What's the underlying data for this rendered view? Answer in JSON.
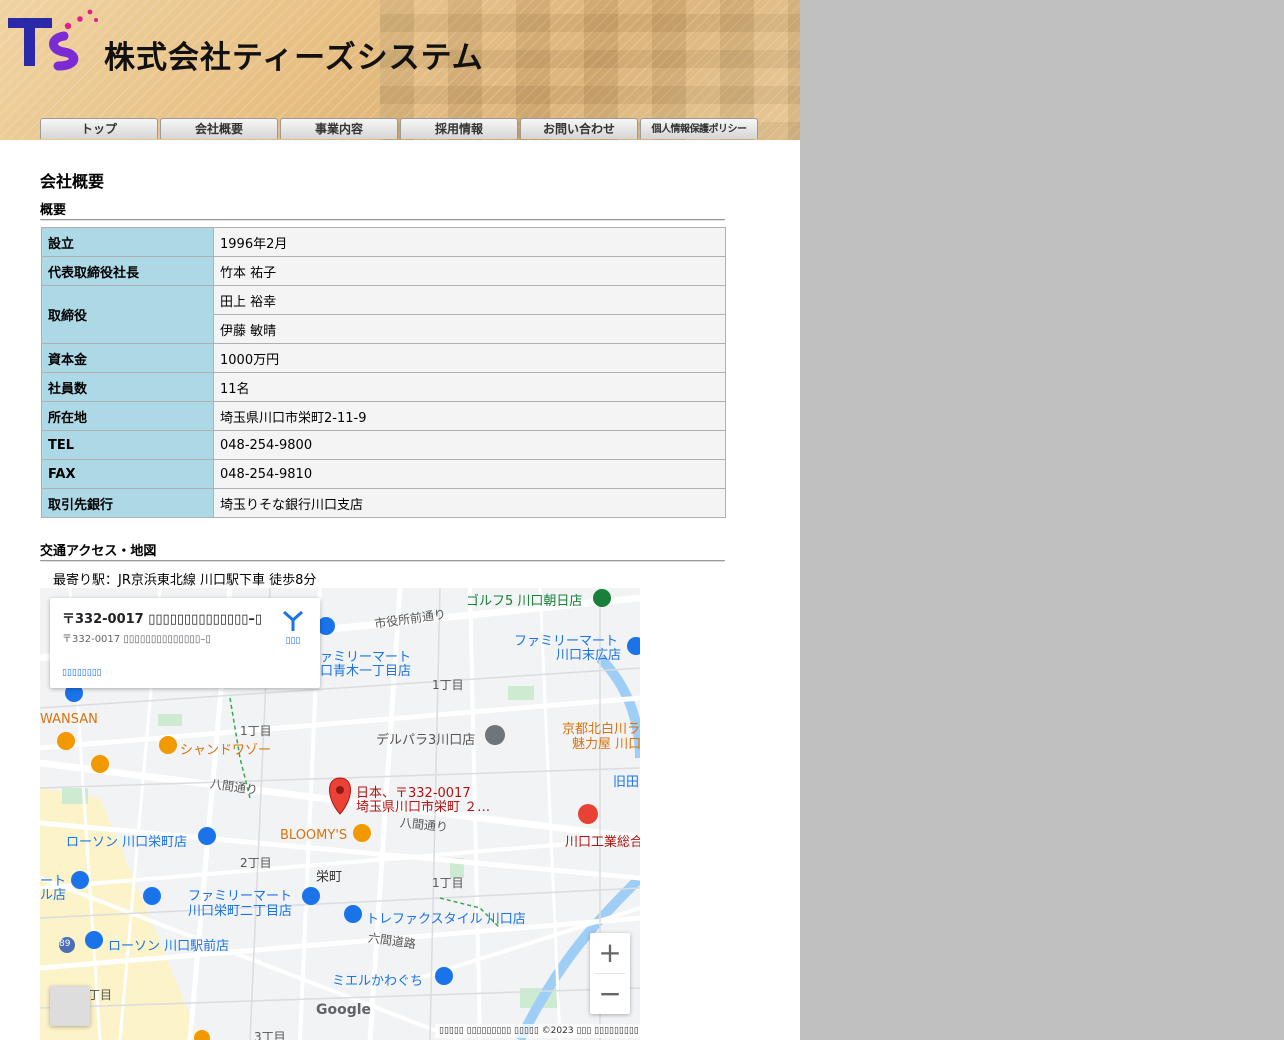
{
  "header": {
    "logo_text": "T's",
    "company_name": "株式会社ティーズシステム"
  },
  "nav": {
    "items": [
      "トップ",
      "会社概要",
      "事業内容",
      "採用情報",
      "お問い合わせ",
      "個人情報保護ポリシー"
    ]
  },
  "page_title": "会社概要",
  "overview": {
    "heading": "概要",
    "rows": [
      {
        "label": "設立",
        "value": "1996年2月"
      },
      {
        "label": "代表取締役社長",
        "value": "竹本 祐子"
      },
      {
        "label": "取締役",
        "values": [
          "田上 裕幸",
          "伊藤 敏晴"
        ]
      },
      {
        "label": "資本金",
        "value": "1000万円"
      },
      {
        "label": "社員数",
        "value": "11名"
      },
      {
        "label": "所在地",
        "value": "埼玉県川口市栄町2-11-9"
      },
      {
        "label": "TEL",
        "value": "048-254-9800"
      },
      {
        "label": "FAX",
        "value": "048-254-9810"
      },
      {
        "label": "取引先銀行",
        "value": "埼玉りそな銀行川口支店"
      }
    ]
  },
  "access": {
    "heading": "交通アクセス・地図",
    "nearest_station": "最寄り駅：JR京浜東北線 川口駅下車 徒歩8分"
  },
  "map": {
    "card_title": "〒332-0017 ▯▯▯▯▯▯▯▯▯▯▯▯▯▯–▯",
    "card_address": "〒332-0017 ▯▯▯▯▯▯▯▯▯▯▯▯▯▯–▯",
    "card_link": "▯▯▯▯▯▯▯▯",
    "directions_label": "▯▯▯",
    "pin_label_line1": "日本、〒332-0017",
    "pin_label_line2": "埼玉県川口市栄町 ２…",
    "google": "Google",
    "attribution": "▯▯▯▯▯ ▯▯▯▯▯▯▯▯▯    ▯▯▯▯▯ ©2023    ▯▯▯    ▯▯▯▯▯▯▯▯▯",
    "places": [
      "ゴルフ5 川口朝日店",
      "市役所前通り",
      "ファミリーマート",
      "川口末広店",
      "ァミリーマート",
      "口青木一丁目店",
      "1丁目",
      "WANSAN",
      "シャンドワゾー",
      "1丁目",
      "デルパラ3川口店",
      "京都北白川ラ",
      "魅力屋 川口",
      "八間通り",
      "旧田",
      "八間通り",
      "BLOOMY'S",
      "ローソン 川口栄町店",
      "川口工業総合",
      "2丁目",
      "栄町",
      "1丁目",
      "ート",
      "ル店",
      "ファミリーマート",
      "川口栄町二丁目店",
      "トレファクスタイル 川口店",
      "六間道路",
      "ローソン 川口駅前店",
      "89",
      "ミエルかわぐち",
      "丁目",
      "3丁目"
    ],
    "zoom_in": "+",
    "zoom_out": "−"
  }
}
